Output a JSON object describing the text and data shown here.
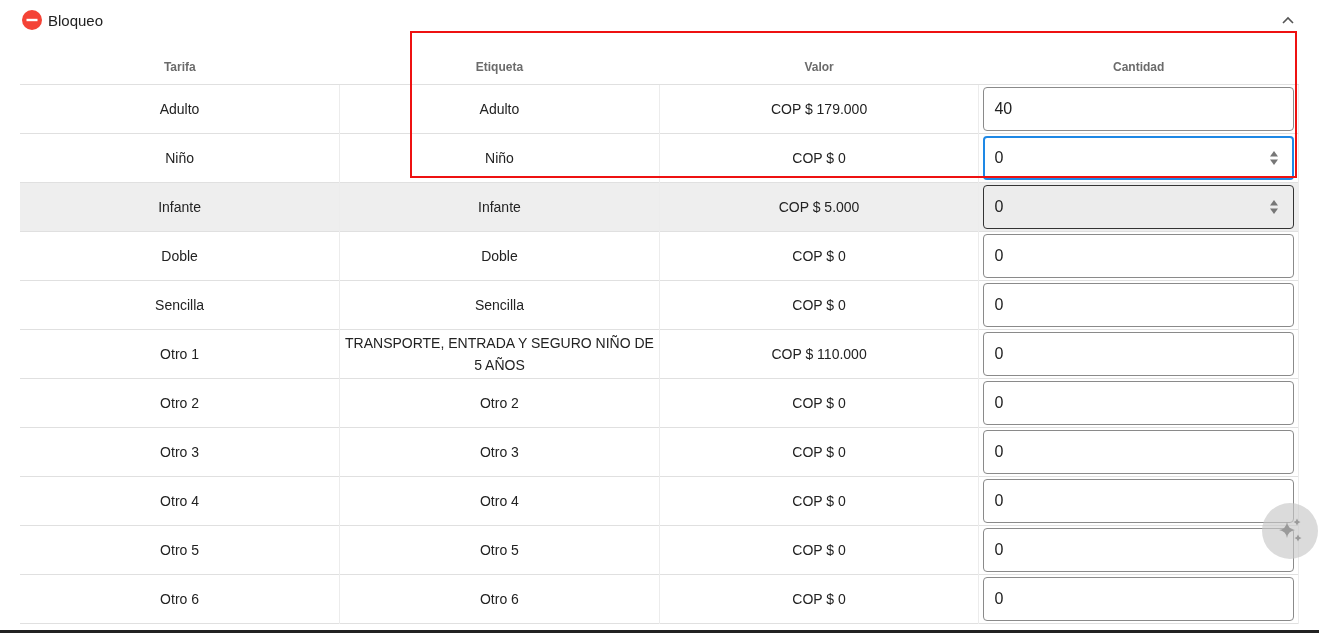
{
  "section": {
    "title": "Bloqueo",
    "expanded": true
  },
  "table": {
    "columns": [
      "Tarifa",
      "Etiqueta",
      "Valor",
      "Cantidad"
    ],
    "rows": [
      {
        "tarifa": "Adulto",
        "etiqueta": "Adulto",
        "valor": "COP $ 179.000",
        "cantidad": "40",
        "hovered": false,
        "focused": false
      },
      {
        "tarifa": "Niño",
        "etiqueta": "Niño",
        "valor": "COP $ 0",
        "cantidad": "0",
        "hovered": false,
        "focused": true
      },
      {
        "tarifa": "Infante",
        "etiqueta": "Infante",
        "valor": "COP $ 5.000",
        "cantidad": "0",
        "hovered": true,
        "focused": false
      },
      {
        "tarifa": "Doble",
        "etiqueta": "Doble",
        "valor": "COP $ 0",
        "cantidad": "0",
        "hovered": false,
        "focused": false
      },
      {
        "tarifa": "Sencilla",
        "etiqueta": "Sencilla",
        "valor": "COP $ 0",
        "cantidad": "0",
        "hovered": false,
        "focused": false
      },
      {
        "tarifa": "Otro 1",
        "etiqueta": "TRANSPORTE, ENTRADA Y SEGURO NIÑO DE 5 AÑOS",
        "valor": "COP $ 110.000",
        "cantidad": "0",
        "hovered": false,
        "focused": false
      },
      {
        "tarifa": "Otro 2",
        "etiqueta": "Otro 2",
        "valor": "COP $ 0",
        "cantidad": "0",
        "hovered": false,
        "focused": false
      },
      {
        "tarifa": "Otro 3",
        "etiqueta": "Otro 3",
        "valor": "COP $ 0",
        "cantidad": "0",
        "hovered": false,
        "focused": false
      },
      {
        "tarifa": "Otro 4",
        "etiqueta": "Otro 4",
        "valor": "COP $ 0",
        "cantidad": "0",
        "hovered": false,
        "focused": false
      },
      {
        "tarifa": "Otro 5",
        "etiqueta": "Otro 5",
        "valor": "COP $ 0",
        "cantidad": "0",
        "hovered": false,
        "focused": false
      },
      {
        "tarifa": "Otro 6",
        "etiqueta": "Otro 6",
        "valor": "COP $ 0",
        "cantidad": "0",
        "hovered": false,
        "focused": false
      }
    ]
  },
  "annotation": {
    "kind": "rectangle"
  }
}
